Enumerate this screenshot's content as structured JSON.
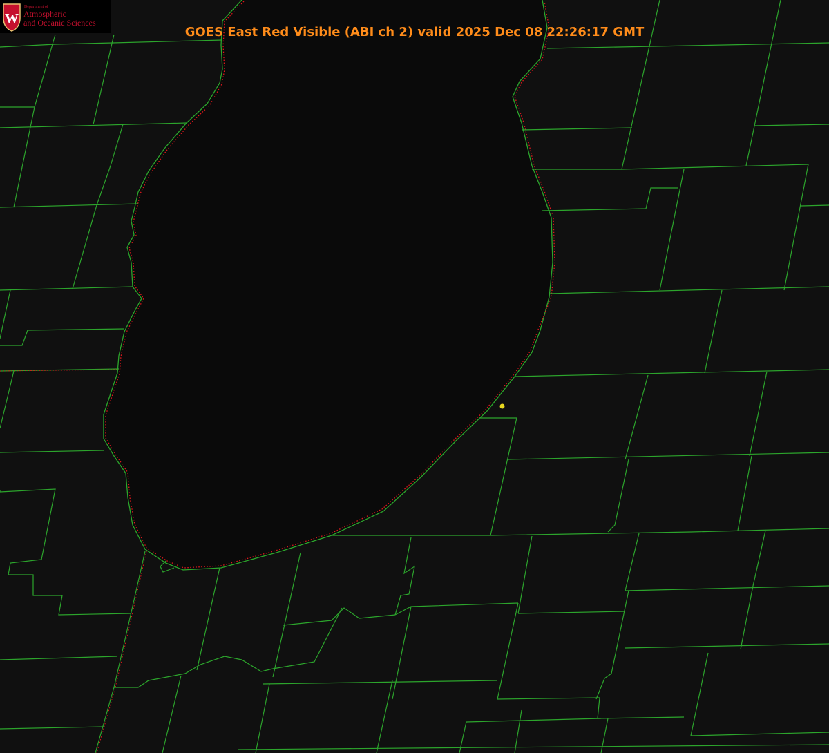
{
  "header": {
    "title": "GOES East Red Visible (ABI ch 2) valid 2025 Dec 08 22:26:17 GMT"
  },
  "logo": {
    "dept_line": "Department of",
    "line1": "Atmospheric",
    "line2": "and Oceanic Sciences",
    "seal_letter": "W"
  },
  "map": {
    "features": [
      "lake-shoreline",
      "county-boundaries",
      "state-boundary",
      "station-marker"
    ]
  },
  "colors": {
    "background": "#101010",
    "county_lines": "#2ca52c",
    "shoreline_dots": "#e0181c",
    "title_text": "#ff8c1a",
    "station_marker": "#e8d820",
    "logo_red": "#c5102e"
  }
}
